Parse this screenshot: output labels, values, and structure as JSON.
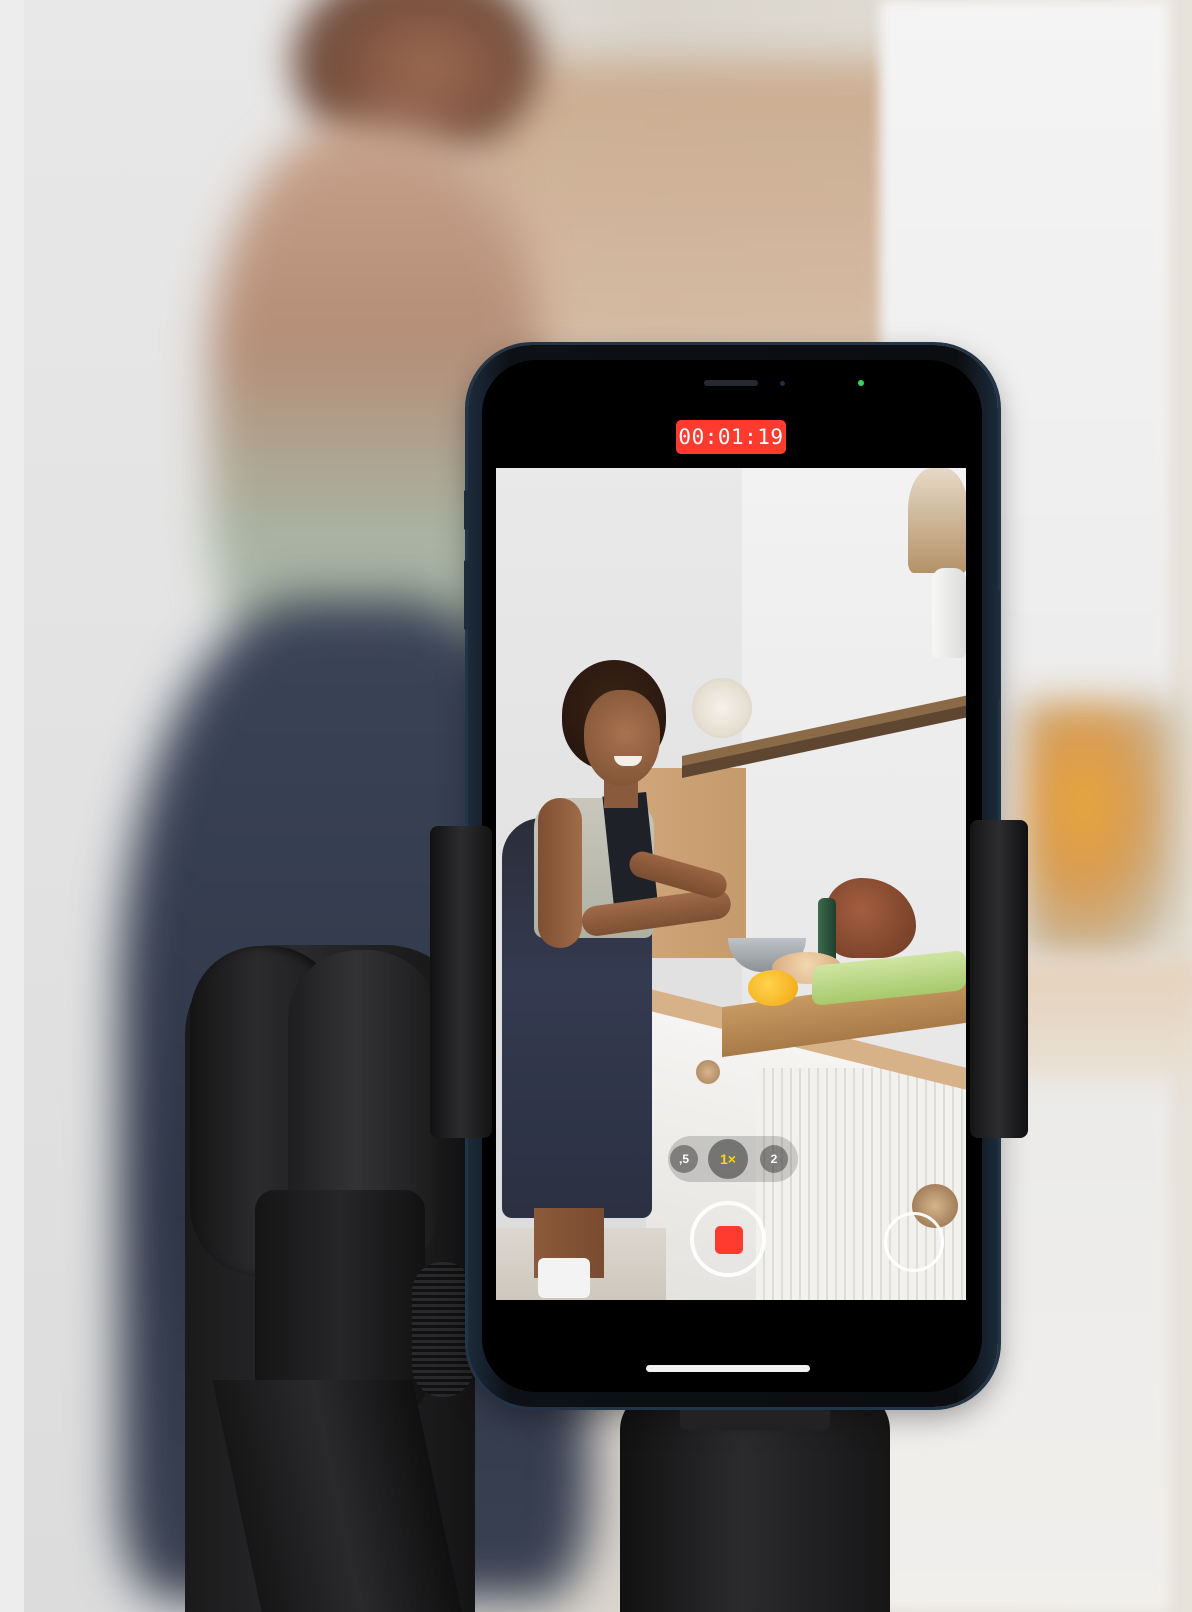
{
  "camera_app": {
    "recording_timer": "00:01:19",
    "zoom_options": [
      {
        "label": ",5",
        "selected": false
      },
      {
        "label": "1×",
        "selected": true
      },
      {
        "label": "2",
        "selected": false
      }
    ],
    "record_state": "recording"
  },
  "colors": {
    "record_red": "#ff3b30",
    "zoom_active_yellow": "#ffd60a",
    "indicator_green": "#35d45a"
  },
  "icons": [
    "stop-recording-icon",
    "capture-photo-icon"
  ]
}
